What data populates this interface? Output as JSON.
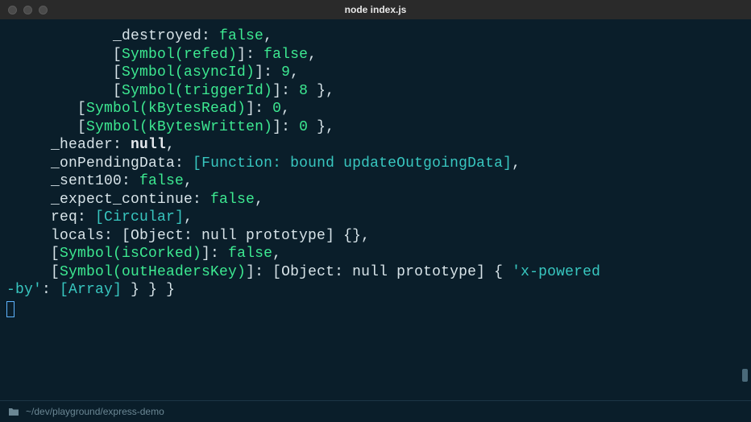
{
  "window": {
    "title": "node index.js"
  },
  "statusbar": {
    "path": "~/dev/playground/express-demo"
  },
  "code": {
    "lines": [
      [
        [
          "plain",
          "            _destroyed: "
        ],
        [
          "kw-bool",
          "false"
        ],
        [
          "plain",
          ","
        ]
      ],
      [
        [
          "plain",
          "            ["
        ],
        [
          "kw-sym",
          "Symbol(refed)"
        ],
        [
          "plain",
          "]: "
        ],
        [
          "kw-bool",
          "false"
        ],
        [
          "plain",
          ","
        ]
      ],
      [
        [
          "plain",
          "            ["
        ],
        [
          "kw-sym",
          "Symbol(asyncId)"
        ],
        [
          "plain",
          "]: "
        ],
        [
          "kw-num",
          "9"
        ],
        [
          "plain",
          ","
        ]
      ],
      [
        [
          "plain",
          "            ["
        ],
        [
          "kw-sym",
          "Symbol(triggerId)"
        ],
        [
          "plain",
          "]: "
        ],
        [
          "kw-num",
          "8"
        ],
        [
          "plain",
          " },"
        ]
      ],
      [
        [
          "plain",
          "        ["
        ],
        [
          "kw-sym",
          "Symbol(kBytesRead)"
        ],
        [
          "plain",
          "]: "
        ],
        [
          "kw-num",
          "0"
        ],
        [
          "plain",
          ","
        ]
      ],
      [
        [
          "plain",
          "        ["
        ],
        [
          "kw-sym",
          "Symbol(kBytesWritten)"
        ],
        [
          "plain",
          "]: "
        ],
        [
          "kw-num",
          "0"
        ],
        [
          "plain",
          " },"
        ]
      ],
      [
        [
          "plain",
          "     _header: "
        ],
        [
          "kw-null",
          "null"
        ],
        [
          "plain",
          ","
        ]
      ],
      [
        [
          "plain",
          "     _onPendingData: "
        ],
        [
          "kw-brkt",
          "["
        ],
        [
          "kw-func",
          "Function: bound updateOutgoingData"
        ],
        [
          "kw-brkt",
          "]"
        ],
        [
          "plain",
          ","
        ]
      ],
      [
        [
          "plain",
          "     _sent100: "
        ],
        [
          "kw-bool",
          "false"
        ],
        [
          "plain",
          ","
        ]
      ],
      [
        [
          "plain",
          "     _expect_continue: "
        ],
        [
          "kw-bool",
          "false"
        ],
        [
          "plain",
          ","
        ]
      ],
      [
        [
          "plain",
          "     req: "
        ],
        [
          "kw-brkt",
          "["
        ],
        [
          "kw-circ",
          "Circular"
        ],
        [
          "kw-brkt",
          "]"
        ],
        [
          "plain",
          ","
        ]
      ],
      [
        [
          "plain",
          "     locals: [Object: null prototype] {},"
        ]
      ],
      [
        [
          "plain",
          "     ["
        ],
        [
          "kw-sym",
          "Symbol(isCorked)"
        ],
        [
          "plain",
          "]: "
        ],
        [
          "kw-bool",
          "false"
        ],
        [
          "plain",
          ","
        ]
      ],
      [
        [
          "plain",
          "     ["
        ],
        [
          "kw-sym",
          "Symbol(outHeadersKey)"
        ],
        [
          "plain",
          "]: [Object: null prototype] { "
        ],
        [
          "kw-str",
          "'x-powered"
        ]
      ],
      [
        [
          "kw-str",
          "-by'"
        ],
        [
          "plain",
          ": "
        ],
        [
          "kw-brkt",
          "["
        ],
        [
          "kw-circ",
          "Array"
        ],
        [
          "kw-brkt",
          "]"
        ],
        [
          "plain",
          " } } }"
        ]
      ]
    ]
  }
}
